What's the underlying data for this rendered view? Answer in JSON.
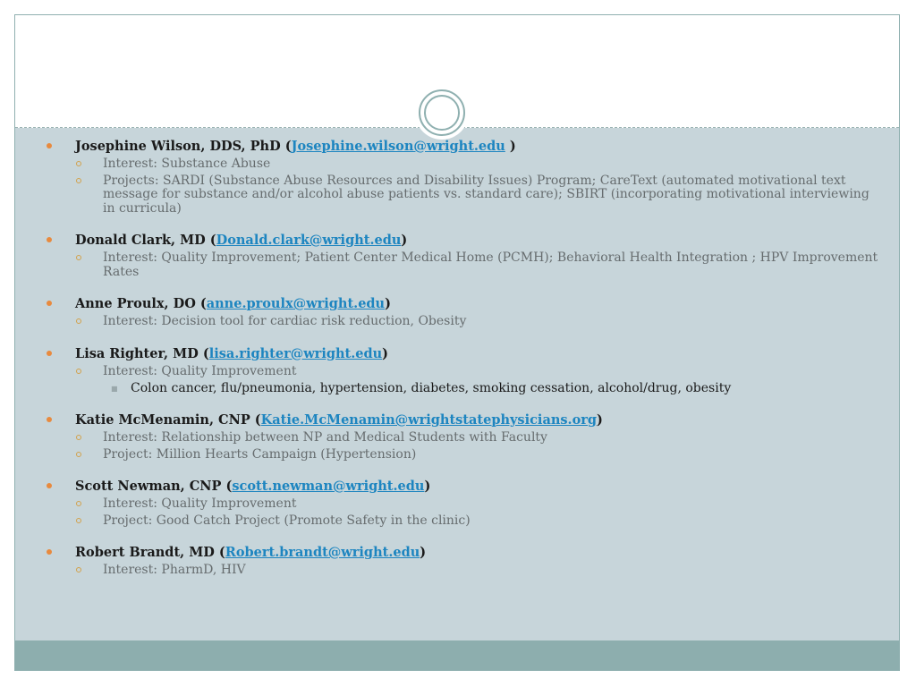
{
  "entries": [
    {
      "name": "Josephine Wilson, DDS, PhD (",
      "email": "Josephine.wilson@wright.edu",
      "close": " )",
      "items": [
        {
          "text": "Interest: Substance Abuse"
        },
        {
          "text": "Projects: SARDI (Substance Abuse Resources and Disability Issues) Program; CareText (automated motivational text message for substance and/or alcohol abuse patients vs. standard care); SBIRT (incorporating motivational interviewing in curricula)"
        }
      ]
    },
    {
      "name": "Donald Clark, MD (",
      "email": "Donald.clark@wright.edu",
      "close": ")",
      "items": [
        {
          "text": "Interest: Quality Improvement; Patient Center Medical Home (PCMH); Behavioral Health Integration ; HPV Improvement Rates"
        }
      ]
    },
    {
      "name": "Anne Proulx, DO (",
      "email": "anne.proulx@wright.edu",
      "close": ")",
      "items": [
        {
          "text": "Interest: Decision tool for cardiac risk reduction, Obesity"
        }
      ]
    },
    {
      "name": "Lisa Righter, MD (",
      "email": "lisa.righter@wright.edu",
      "close": ")",
      "items": [
        {
          "text": "Interest: Quality Improvement",
          "sub": "Colon cancer, flu/pneumonia, hypertension, diabetes, smoking cessation, alcohol/drug, obesity"
        }
      ]
    },
    {
      "name": "Katie McMenamin, CNP (",
      "email": "Katie.McMenamin@wrightstatephysicians.org",
      "close": ")",
      "items": [
        {
          "text": "Interest: Relationship between NP and Medical Students with Faculty"
        },
        {
          "text": "Project: Million Hearts Campaign (Hypertension)"
        }
      ]
    },
    {
      "name": "Scott Newman, CNP (",
      "email": "scott.newman@wright.edu",
      "close": ")",
      "items": [
        {
          "text": "Interest: Quality Improvement"
        },
        {
          "text": "Project: Good Catch Project (Promote Safety in the clinic)"
        }
      ]
    },
    {
      "name": "Robert Brandt, MD (",
      "email": "Robert.brandt@wright.edu",
      "close": ")",
      "items": [
        {
          "text": "Interest: PharmD, HIV"
        }
      ]
    }
  ]
}
